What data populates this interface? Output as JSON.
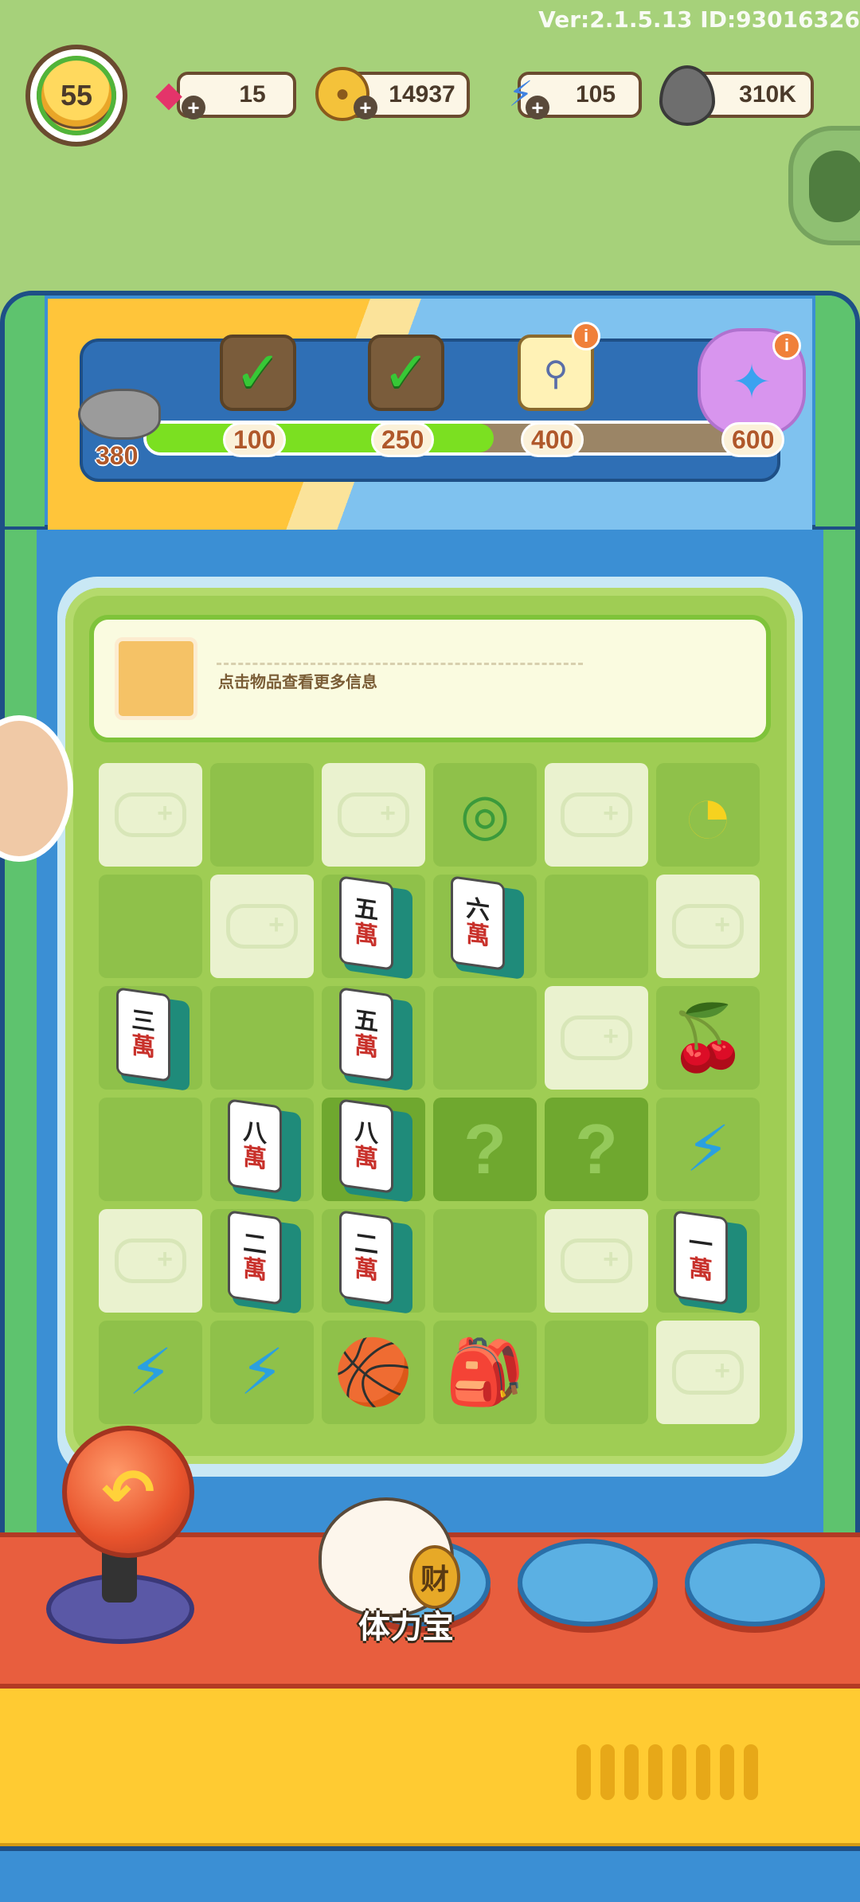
{
  "version_text": "Ver:2.1.5.13 ID:93016326",
  "player": {
    "level": "55"
  },
  "resources": {
    "gems": "15",
    "coins": "14937",
    "energy": "105",
    "seeds": "310K"
  },
  "progress": {
    "current": "380",
    "fraction": 0.58,
    "milestones": [
      {
        "value": "100",
        "claimed": true,
        "reward_icon": "treasure-chest-icon"
      },
      {
        "value": "250",
        "claimed": true,
        "reward_icon": "treasure-chest-icon"
      },
      {
        "value": "400",
        "claimed": false,
        "reward_icon": "fishing-rod-icon"
      },
      {
        "value": "600",
        "claimed": false,
        "reward_icon": "shuriken-icon"
      }
    ]
  },
  "info_panel": {
    "hint": "点击物品查看更多信息"
  },
  "tiles": {
    "wan_char": "萬",
    "five": "五",
    "six": "六",
    "three": "三",
    "eight": "八",
    "two": "二",
    "one": "一"
  },
  "grid_icons": {
    "question": "?",
    "ring": "◎",
    "pacman": "◔",
    "cherry": "🍒",
    "backpack": "🎒",
    "basketball_hoop": "🏀",
    "energy_machine": "⚡"
  },
  "bottom": {
    "joystick_arrow": "↶",
    "cat_coin": "财",
    "cat_label": "体力宝"
  },
  "colors": {
    "background": "#a6d17a",
    "machine_blue": "#3b8fd4",
    "progress_green": "#7be021",
    "controls_red": "#e85e3e",
    "base_yellow": "#ffcb32"
  }
}
